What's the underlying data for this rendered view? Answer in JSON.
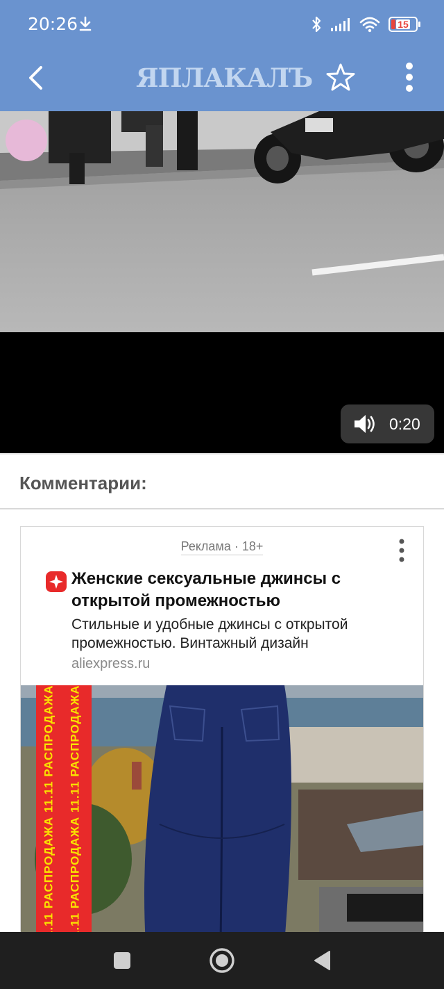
{
  "status_bar": {
    "time": "20:26",
    "battery": "15",
    "battery_color": "#e8453c",
    "icons": [
      "download-icon",
      "bluetooth-icon",
      "signal-icon",
      "wifi-icon",
      "battery-icon"
    ]
  },
  "app_bar": {
    "logo": "ЯПЛАКАЛЪ",
    "background": "#6a93cf",
    "icons": [
      "back-arrow-icon",
      "star-icon",
      "more-vertical-icon"
    ]
  },
  "video": {
    "duration": "0:20",
    "icons": [
      "volume-icon"
    ]
  },
  "comments": {
    "title": "Комментарии:"
  },
  "ad": {
    "label": "Реклама · 18+",
    "title": "Женские сексуальные джинсы с открытой промежностью",
    "text": "Стильные и удобные джинсы с открытой промежностью. Винтажный дизайн",
    "domain": "aliexpress.ru",
    "promo_text": "11.11 РАСПРОДАЖА 11.11 РАСПРОДАЖА",
    "promo_colors": {
      "background": "#e82a2a",
      "text": "#f9e300"
    },
    "icons": [
      "aliexpress-logo-icon",
      "more-vertical-icon"
    ]
  },
  "nav_bar": {
    "icons": [
      "recents-square-icon",
      "home-circle-icon",
      "back-triangle-icon"
    ]
  }
}
